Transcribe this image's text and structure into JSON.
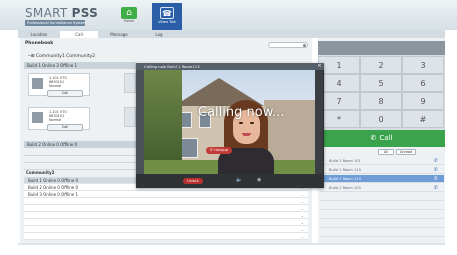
{
  "app": {
    "title_part1": "SMART ",
    "title_part2": "PSS",
    "subtitle": "Professional Surveillance System"
  },
  "nav": {
    "home": {
      "label": "Home",
      "icon": "home-icon"
    },
    "videotalk": {
      "label": "Video Talk",
      "icon": "video-talk-icon"
    }
  },
  "tabs": [
    {
      "label": "Location"
    },
    {
      "label": "Call"
    },
    {
      "label": "Message"
    },
    {
      "label": "Log"
    }
  ],
  "phonebook": {
    "title": "Phonebook",
    "community_row": "─⊞  Community1  Community2",
    "build_header": "Build 1   Online 3   Offline 1",
    "cards": [
      {
        "line1": "1-101  VTO",
        "line2": "6830101",
        "line3": "Normal",
        "call_label": "Call"
      },
      {
        "line1": "1-101  VTO",
        "line2": "6830101",
        "line3": "Normal",
        "call_label": "Call"
      }
    ],
    "build2_row": "Build 2   Online 0   Offline 0",
    "community2_title": "Community2",
    "community2_rows": [
      "Build 1   Online 0   Offline 0",
      "Build 2   Online 0   Offline 0",
      "Build 3   Online 0   Offline 1"
    ]
  },
  "keypad": {
    "keys": [
      "1",
      "2",
      "3",
      "4",
      "5",
      "6",
      "7",
      "8",
      "9",
      "*",
      "0",
      "#"
    ],
    "call_label": "Call",
    "call_icon": "phone-icon"
  },
  "recent_calls": {
    "tabs": [
      "All",
      "Unread"
    ],
    "items": [
      {
        "label": "Build 1 Room 101",
        "selected": false
      },
      {
        "label": "Build 1 Room 113",
        "selected": false
      },
      {
        "label": "Build 1 Room 113",
        "selected": true
      },
      {
        "label": "Build 1 Room 103",
        "selected": false
      }
    ]
  },
  "call_popup": {
    "title": "Calling now Build 1 Room113",
    "status_text": "Calling now...",
    "hangup_label": "Hangup",
    "unlock_label": "Unlock",
    "mute_icon": "mute-icon",
    "snapshot_icon": "snapshot-icon",
    "close_icon": "close-icon"
  },
  "colors": {
    "accent_blue": "#2a5fa8",
    "call_green": "#3aa34b",
    "hangup_red": "#c33a36",
    "selected_row": "#6e9cd6"
  }
}
